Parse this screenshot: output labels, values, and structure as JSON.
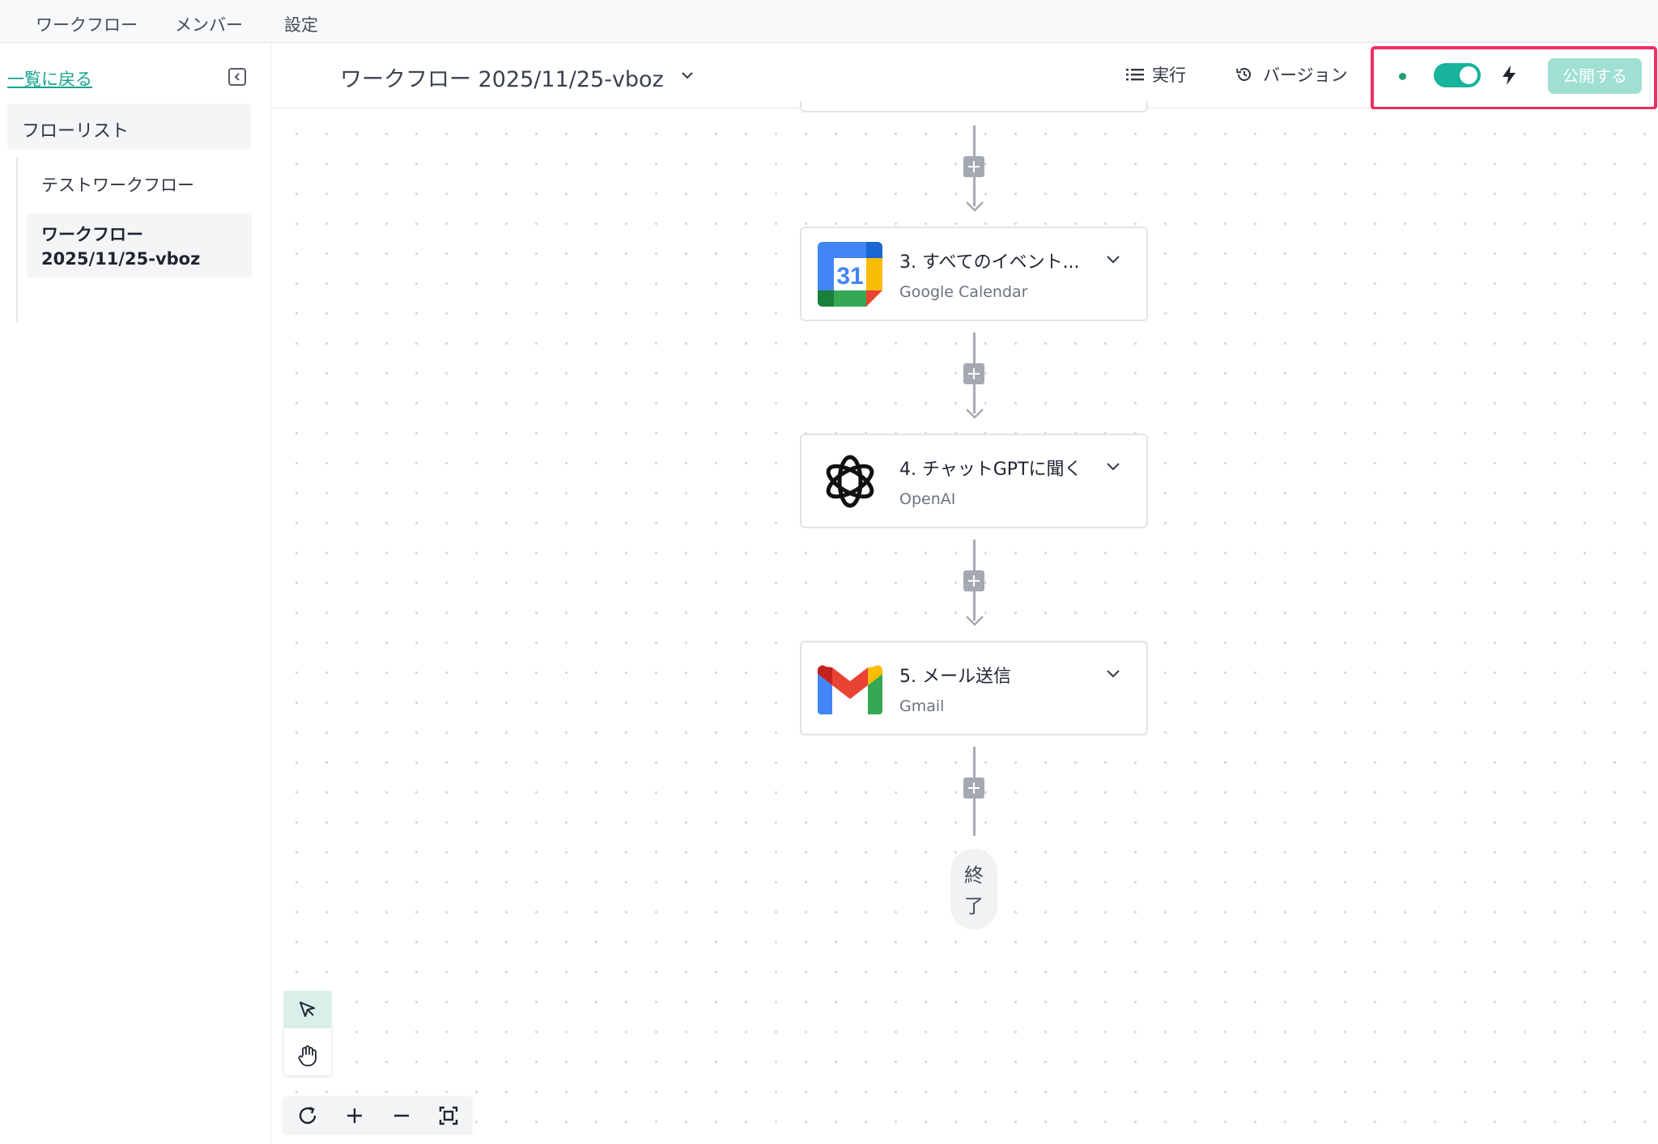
{
  "topnav": {
    "items": [
      "ワークフロー",
      "メンバー",
      "設定"
    ]
  },
  "sidebar": {
    "back_label": "一覧に戻る",
    "collapse_icon": "collapse-sidebar-icon",
    "list_header": "フローリスト",
    "flows": [
      "テストワークフロー",
      "ワークフロー 2025/11/25-vboz"
    ],
    "active_index": 1
  },
  "header": {
    "title": "ワークフロー 2025/11/25-vboz",
    "run_label": "実行",
    "version_label": "バージョン",
    "status_color": "#22a06b",
    "toggle_on": true,
    "publish_label": "公開する",
    "accent": "#17b39b",
    "highlight_color": "#ee2f62"
  },
  "nodes": [
    {
      "title": "3. すべてのイベント...",
      "service": "Google Calendar",
      "icon": "google-calendar-icon",
      "calendar_day": "31"
    },
    {
      "title": "4. チャットGPTに聞く",
      "service": "OpenAI",
      "icon": "openai-icon"
    },
    {
      "title": "5. メール送信",
      "service": "Gmail",
      "icon": "gmail-icon"
    }
  ],
  "end_node": {
    "line1": "終",
    "line2": "了"
  },
  "tools": {
    "select": "pointer-icon",
    "pan": "hand-icon",
    "selected": "select"
  },
  "zoom_controls": [
    "refresh-icon",
    "zoom-in-icon",
    "zoom-out-icon",
    "fit-view-icon"
  ]
}
